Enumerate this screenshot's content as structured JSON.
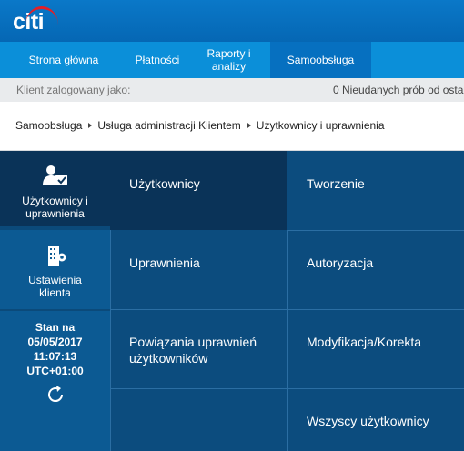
{
  "brand": {
    "logo_text": "citi",
    "arc_color": "#e31f26",
    "header_color": "#0a78c8"
  },
  "nav": {
    "tabs": [
      {
        "label": "Strona główna"
      },
      {
        "label": "Płatności"
      },
      {
        "label": "Raporty i analizy"
      },
      {
        "label": "Samoobsługa",
        "active": true
      }
    ],
    "active_color": "#0670c0"
  },
  "status": {
    "logged_in_label": "Klient zalogowany jako:",
    "failed_attempts": "0 Nieudanych prób od osta"
  },
  "breadcrumb": [
    "Samoobsługa",
    "Usługa administracji Klientem",
    "Użytkownicy i uprawnienia"
  ],
  "rail": {
    "users": {
      "label": "Użytkownicy i uprawnienia",
      "icon": "user-check-icon"
    },
    "settings": {
      "label": "Ustawienia klienta",
      "icon": "building-gear-icon"
    },
    "timestamp": {
      "label": "Stan na",
      "date": "05/05/2017",
      "time": "11:07:13",
      "timezone": "UTC+01:00",
      "icon": "refresh-icon"
    }
  },
  "menu": {
    "users": "Użytkownicy",
    "create": "Tworzenie",
    "permissions": "Uprawnienia",
    "authorize": "Autoryzacja",
    "permission_links": "Powiązania uprawnień użytkowników",
    "modify": "Modyfikacja/Korekta",
    "all_users": "Wszyscy użytkownicy"
  },
  "colors": {
    "panel_dark": "#0a3358",
    "panel": "#0c4c7e",
    "rail_light": "#0c5a93"
  }
}
